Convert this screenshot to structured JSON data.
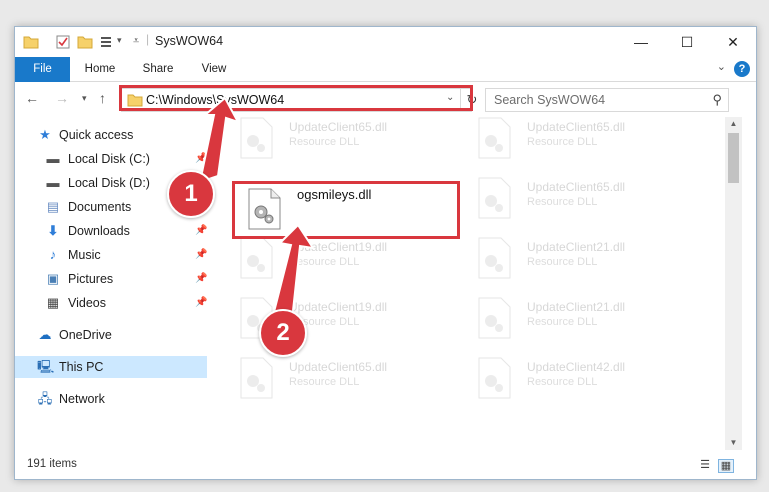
{
  "window": {
    "title": "SysWOW64",
    "min_label": "—",
    "max_label": "☐",
    "close_label": "✕"
  },
  "ribbon": {
    "tabs": [
      "File",
      "Home",
      "Share",
      "View"
    ],
    "help_label": "?"
  },
  "address": {
    "path": "C:\\Windows\\SysWOW64"
  },
  "search": {
    "placeholder": "Search SysWOW64"
  },
  "sidebar": {
    "items": [
      {
        "label": "Quick access",
        "icon": "star-icon"
      },
      {
        "label": "Local Disk (C:)",
        "icon": "drive-icon"
      },
      {
        "label": "Local Disk (D:)",
        "icon": "drive-icon"
      },
      {
        "label": "Documents",
        "icon": "documents-icon"
      },
      {
        "label": "Downloads",
        "icon": "download-icon"
      },
      {
        "label": "Music",
        "icon": "music-icon"
      },
      {
        "label": "Pictures",
        "icon": "pictures-icon"
      },
      {
        "label": "Videos",
        "icon": "videos-icon"
      },
      {
        "label": "OneDrive",
        "icon": "cloud-icon"
      },
      {
        "label": "This PC",
        "icon": "computer-icon"
      },
      {
        "label": "Network",
        "icon": "network-icon"
      }
    ]
  },
  "files": [
    {
      "name": "UpdateClient65.dll",
      "desc": "Resource DLL"
    },
    {
      "name": "UpdateClient65.dll",
      "desc": "Resource DLL"
    },
    {
      "name": "ogsmileys.dll",
      "desc": ""
    },
    {
      "name": "UpdateClient65.dll",
      "desc": "Resource DLL"
    },
    {
      "name": "UpdateClient19.dll",
      "desc": "Resource DLL"
    },
    {
      "name": "UpdateClient21.dll",
      "desc": "Resource DLL"
    },
    {
      "name": "UpdateClient19.dll",
      "desc": "Resource DLL"
    },
    {
      "name": "UpdateClient21.dll",
      "desc": "Resource DLL"
    },
    {
      "name": "UpdateClient65.dll",
      "desc": "Resource DLL"
    },
    {
      "name": "UpdateClient42.dll",
      "desc": "Resource DLL"
    }
  ],
  "status": {
    "item_count": "191 items"
  },
  "annotations": {
    "step1": "1",
    "step2": "2",
    "color": "#d9373e"
  }
}
